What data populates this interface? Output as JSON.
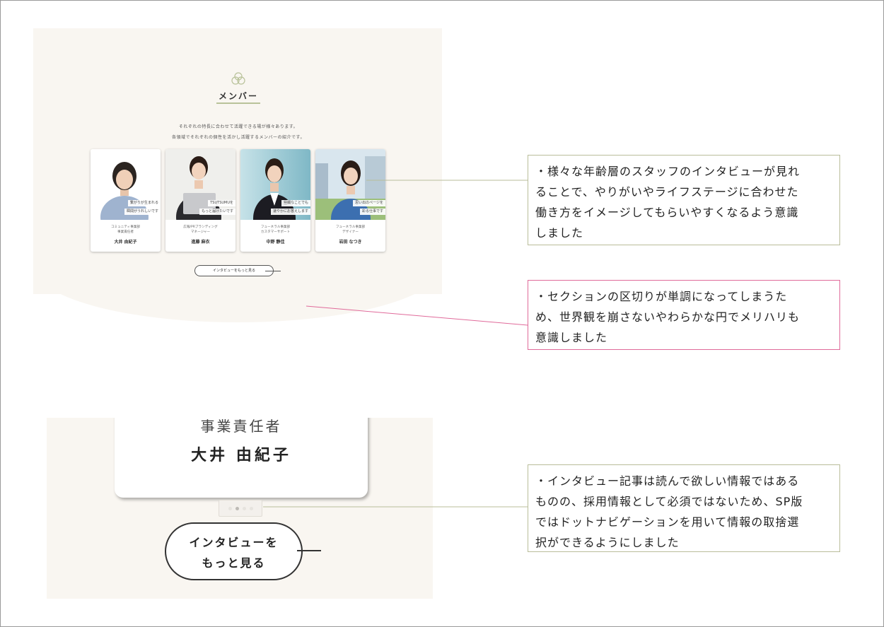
{
  "section": {
    "title": "メンバー",
    "lead": [
      "それぞれの特長に合わせて活躍できる場が様々あります。",
      "各領域でそれぞれの個性を活かし活躍するメンバーの紹介です。"
    ]
  },
  "members": [
    {
      "catch": [
        "繋がりが生まれる",
        "瞬間がうれしいです"
      ],
      "dept": [
        "コミュニティ事業部",
        "事業責任者"
      ],
      "name": "大井 由紀子"
    },
    {
      "catch": [
        "TSUTSUMUを",
        "もっと届けたいです"
      ],
      "dept": [
        "広報/PRブランディング",
        "マネージャー"
      ],
      "name": "進藤 麻衣"
    },
    {
      "catch": [
        "些細なことでも",
        "速やかにお答えします"
      ],
      "dept": [
        "フューネラル事業部",
        "カスタマーサポート"
      ],
      "name": "中野 静佳"
    },
    {
      "catch": [
        "思い出のページを",
        "彩る仕事です"
      ],
      "dept": [
        "フューネラル事業部",
        "デザイナー"
      ],
      "name": "岩田 なつき"
    }
  ],
  "more_button": "インタビューをもっと見る",
  "sp": {
    "role": "事業責任者",
    "name": "大井 由紀子",
    "dots": {
      "count": 4,
      "active": 1
    },
    "button": [
      "インタビューを",
      "もっと見る"
    ]
  },
  "notes": [
    {
      "lines": [
        "・様々な年齢層のスタッフのインタビューが見れ",
        "ることで、やりがいやライフステージに合わせた",
        "働き方をイメージしてもらいやすくなるよう意識",
        "しました"
      ],
      "color": "#b9bd9a"
    },
    {
      "lines": [
        "・セクションの区切りが単調になってしまうた",
        "め、世界観を崩さないやわらかな円でメリハリも",
        "意識しました"
      ],
      "color": "#e06a9a"
    },
    {
      "lines": [
        "・インタビュー記事は読んで欲しい情報ではある",
        "ものの、採用情報として必須ではないため、SP版",
        "ではドットナビゲーションを用いて情報の取捨選",
        "択ができるようにしました"
      ],
      "color": "#b9bd9a"
    }
  ]
}
